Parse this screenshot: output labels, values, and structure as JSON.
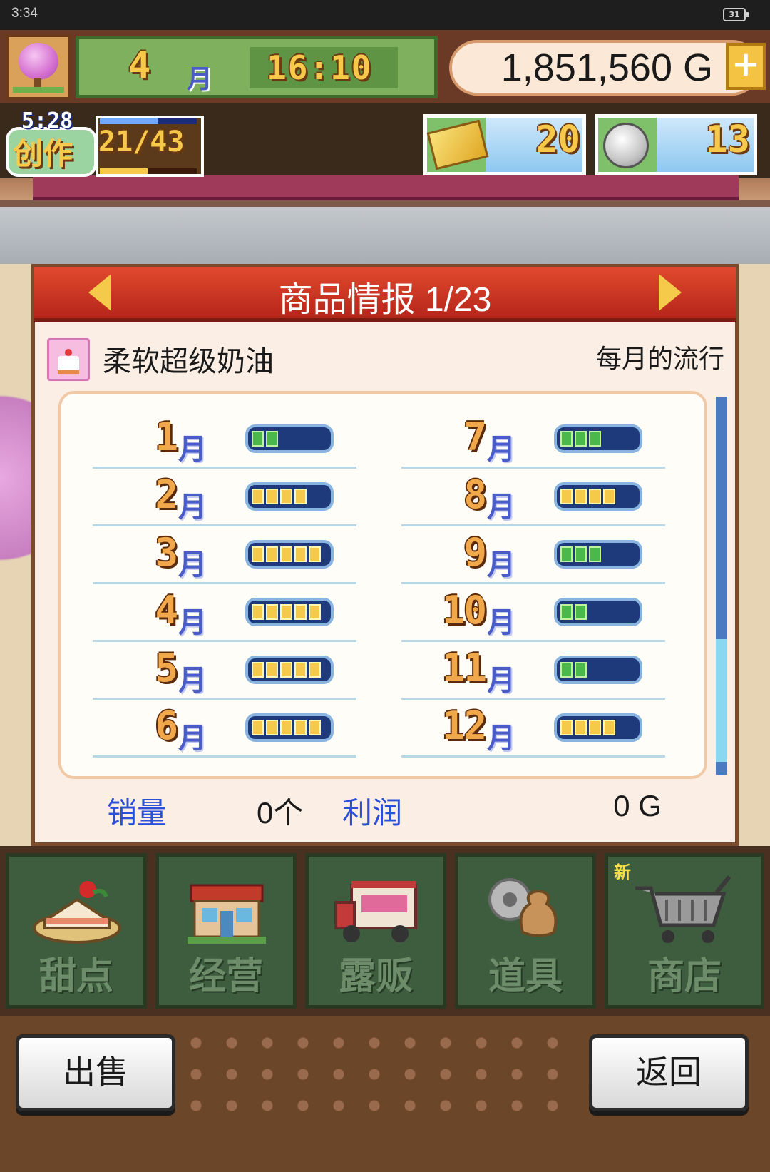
{
  "status_bar": {
    "time": "3:34",
    "battery": "31"
  },
  "hud": {
    "month_number": "4",
    "month_unit": "月",
    "clock": "16:10",
    "money": "1,851,560 G",
    "add_money_label": "+"
  },
  "creation": {
    "timer": "5:28",
    "label": "创作",
    "progress": "21/43"
  },
  "resources": [
    {
      "icon": "gold-ticket-icon",
      "value": "20"
    },
    {
      "icon": "silver-medal-icon",
      "value": "13"
    }
  ],
  "dialog": {
    "title": "商品情报 1/23",
    "item_name": "柔软超级奶油",
    "trend_label": "每月的流行",
    "unit": "月",
    "months": [
      {
        "month": "1",
        "level": 2,
        "color": "green"
      },
      {
        "month": "2",
        "level": 4,
        "color": "yellow"
      },
      {
        "month": "3",
        "level": 5,
        "color": "yellow"
      },
      {
        "month": "4",
        "level": 5,
        "color": "yellow"
      },
      {
        "month": "5",
        "level": 5,
        "color": "yellow"
      },
      {
        "month": "6",
        "level": 5,
        "color": "yellow"
      },
      {
        "month": "7",
        "level": 3,
        "color": "green"
      },
      {
        "month": "8",
        "level": 4,
        "color": "yellow"
      },
      {
        "month": "9",
        "level": 3,
        "color": "green"
      },
      {
        "month": "10",
        "level": 2,
        "color": "green"
      },
      {
        "month": "11",
        "level": 2,
        "color": "green"
      },
      {
        "month": "12",
        "level": 4,
        "color": "yellow"
      }
    ],
    "max_level": 5,
    "sales_label": "销量",
    "sales_value": "0个",
    "profit_label": "利润",
    "profit_value": "0 G"
  },
  "nav": [
    {
      "label": "甜点",
      "icon": "cake-icon"
    },
    {
      "label": "经营",
      "icon": "shop-building-icon"
    },
    {
      "label": "露贩",
      "icon": "food-truck-icon"
    },
    {
      "label": "道具",
      "icon": "items-bag-icon"
    },
    {
      "label": "商店",
      "icon": "shopping-cart-icon",
      "badge": "新"
    }
  ],
  "footer": {
    "sell_label": "出售",
    "back_label": "返回"
  }
}
